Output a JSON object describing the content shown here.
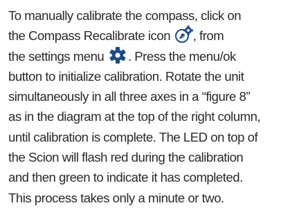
{
  "paragraph": {
    "lines": [
      {
        "text": "To manually calibrate the compass, click on"
      },
      {
        "before": "the Compass Recalibrate icon ",
        "icon": "compass-recalibrate-icon",
        "after": ", from"
      },
      {
        "before": "the settings menu ",
        "icon": "settings-gear-icon",
        "after": ". Press the menu/ok"
      },
      {
        "text": "button to initialize calibration. Rotate the unit"
      },
      {
        "text": "simultaneously in all three axes in a “figure 8”"
      },
      {
        "text": "as in the diagram at the top of the right column,"
      },
      {
        "text": "until calibration is complete. The LED on top of"
      },
      {
        "text": "the Scion will flash red during the calibration"
      },
      {
        "text": "and then green to indicate it has completed."
      },
      {
        "text": "This process takes only a minute or two."
      }
    ]
  },
  "colors": {
    "text": "#2a2a2a",
    "icon_accent": "#1b4a8c"
  }
}
